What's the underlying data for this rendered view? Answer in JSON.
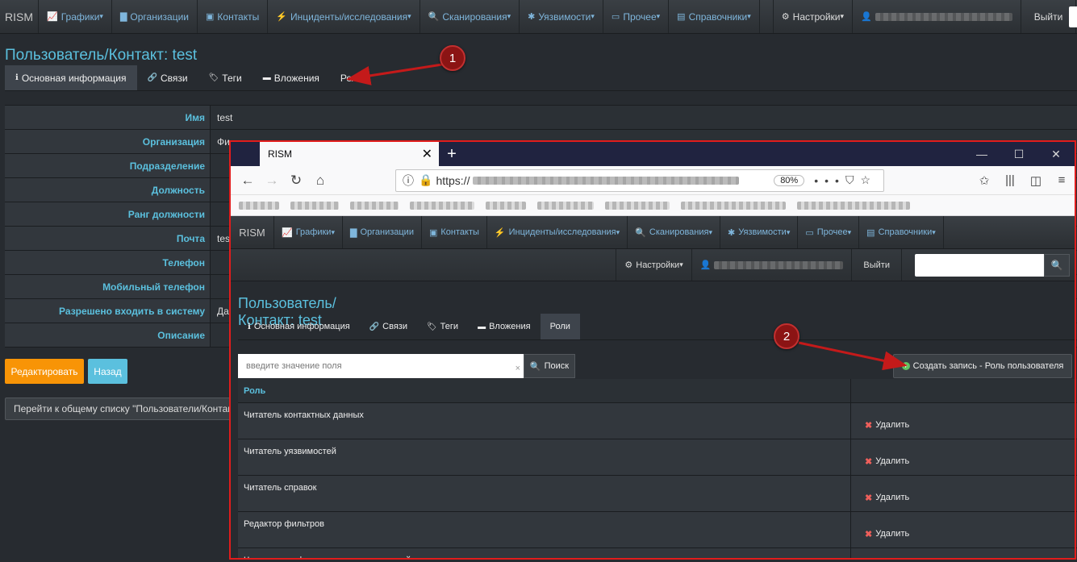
{
  "nav": {
    "brand": "RISM",
    "items": [
      {
        "icon": "chart-icon",
        "label": "Графики",
        "dropdown": true
      },
      {
        "icon": "building-icon",
        "label": "Организации",
        "dropdown": false
      },
      {
        "icon": "id-card-icon",
        "label": "Контакты",
        "dropdown": false
      },
      {
        "icon": "bolt-icon",
        "label": "Инциденты/исследования",
        "dropdown": true
      },
      {
        "icon": "search-icon",
        "label": "Сканирования",
        "dropdown": true
      },
      {
        "icon": "bug-icon",
        "label": "Уязвимости",
        "dropdown": true
      },
      {
        "icon": "inbox-icon",
        "label": "Прочее",
        "dropdown": true
      },
      {
        "icon": "book-icon",
        "label": "Справочники",
        "dropdown": true
      }
    ],
    "settings": "Настройки",
    "logout": "Выйти"
  },
  "page": {
    "title": "Пользователь/Контакт: test",
    "tabs": [
      {
        "icon": "info-icon",
        "label": "Основная информация",
        "active": true
      },
      {
        "icon": "link-icon",
        "label": "Связи",
        "active": false
      },
      {
        "icon": "tags-icon",
        "label": "Теги",
        "active": false
      },
      {
        "icon": "folder-icon",
        "label": "Вложения",
        "active": false
      },
      {
        "icon": "",
        "label": "Роли",
        "active": false
      }
    ],
    "fields": [
      {
        "label": "Имя",
        "value": "test"
      },
      {
        "label": "Организация",
        "value": "Фи"
      },
      {
        "label": "Подразделение",
        "value": ""
      },
      {
        "label": "Должность",
        "value": ""
      },
      {
        "label": "Ранг должности",
        "value": ""
      },
      {
        "label": "Почта",
        "value": "tes"
      },
      {
        "label": "Телефон",
        "value": ""
      },
      {
        "label": "Мобильный телефон",
        "value": ""
      },
      {
        "label": "Разрешено входить в систему",
        "value": "Да"
      },
      {
        "label": "Описание",
        "value": ""
      }
    ],
    "edit_button": "Редактировать",
    "back_button": "Назад",
    "list_button": "Перейти к общему списку \"Пользователи/Контакты\""
  },
  "annotations": {
    "badge1": "1",
    "badge2": "2"
  },
  "browser": {
    "tab_title": "RISM",
    "url": "https://",
    "zoom": "80%",
    "inner": {
      "title": "Пользователь/Контакт: test",
      "active_tab": "Роли",
      "filter_placeholder": "введите значение поля",
      "filter_clear": "×",
      "search_button": "Поиск",
      "create_button": "Создать запись - Роль пользователя",
      "column_role": "Роль",
      "delete_label": "Удалить",
      "roles": [
        "Читатель контактных данных",
        "Читатель уязвимостей",
        "Читатель справок",
        "Редактор фильтров",
        "Читатель графиков конкретных моделей"
      ]
    }
  },
  "colors": {
    "accent": "#5bc0de",
    "warning": "#f89406",
    "danger": "#ee5f5b",
    "highlight": "#e21c1c"
  }
}
